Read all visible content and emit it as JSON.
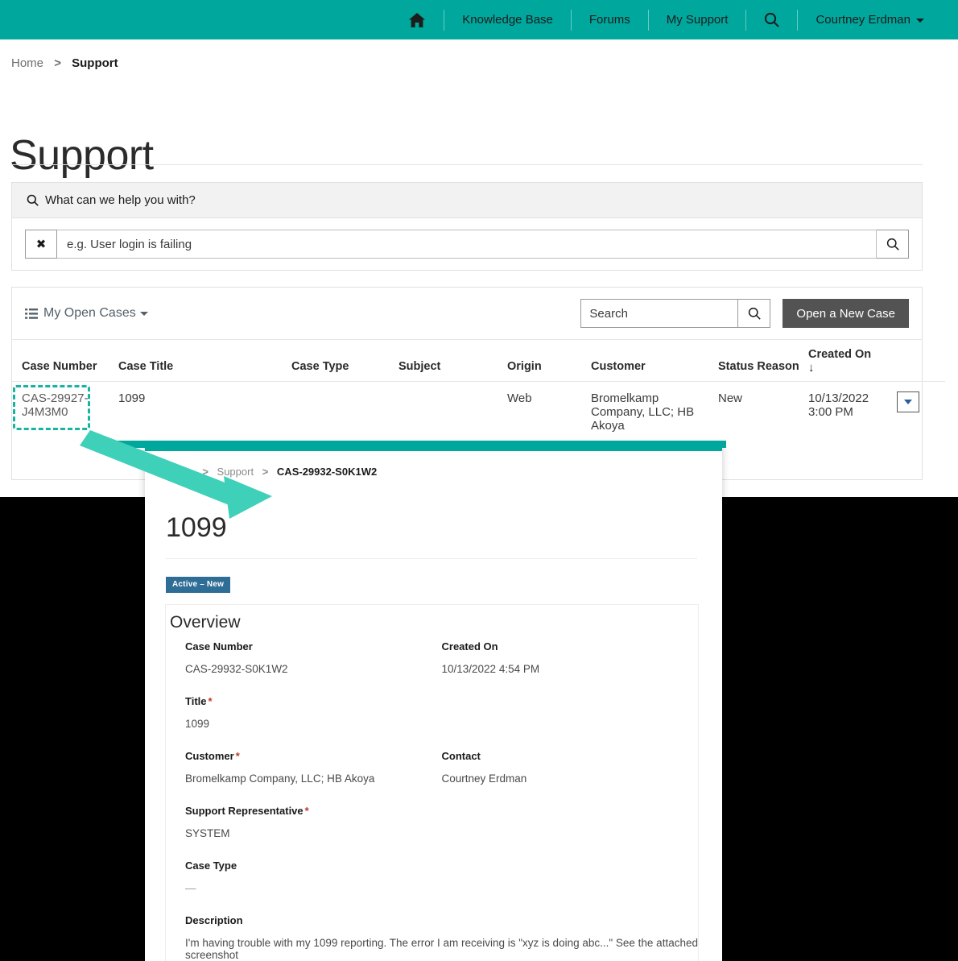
{
  "topnav": {
    "home_icon": "home-icon",
    "items": [
      {
        "label": "Knowledge Base"
      },
      {
        "label": "Forums"
      },
      {
        "label": "My Support"
      }
    ],
    "search_icon": "search-icon",
    "user": "Courtney Erdman"
  },
  "breadcrumb": {
    "home": "Home",
    "separator": ">",
    "current": "Support"
  },
  "page": {
    "title": "Support"
  },
  "help": {
    "header": "What can we help you with?",
    "clear_label": "✖",
    "placeholder": "e.g. User login is failing",
    "value": ""
  },
  "toolbar": {
    "view_label": "My Open Cases",
    "search_placeholder": "Search",
    "search_value": "",
    "new_case_label": "Open a New Case"
  },
  "table": {
    "headers": {
      "case_number": "Case Number",
      "case_title": "Case Title",
      "case_type": "Case Type",
      "subject": "Subject",
      "origin": "Origin",
      "customer": "Customer",
      "status_reason": "Status Reason",
      "created_on": "Created On",
      "sort_arrow": "↓"
    },
    "rows": [
      {
        "case_number": "CAS-29927-J4M3M0",
        "case_title": "1099",
        "case_type": "",
        "subject": "",
        "origin": "Web",
        "customer": "Bromelkamp Company, LLC; HB Akoya",
        "status_reason": "New",
        "created_on": "10/13/2022 3:00 PM"
      }
    ]
  },
  "detail": {
    "breadcrumb": {
      "home": "Home",
      "support": "Support",
      "separator": ">",
      "current": "CAS-29932-S0K1W2"
    },
    "title": "1099",
    "badge": "Active – New",
    "section_title": "Overview",
    "fields": {
      "case_number_label": "Case Number",
      "case_number_value": "CAS-29932-S0K1W2",
      "created_on_label": "Created On",
      "created_on_value": "10/13/2022 4:54 PM",
      "title_label": "Title",
      "title_value": "1099",
      "customer_label": "Customer",
      "customer_value": "Bromelkamp Company, LLC; HB Akoya",
      "contact_label": "Contact",
      "contact_value": "Courtney Erdman",
      "support_rep_label": "Support Representative",
      "support_rep_value": "SYSTEM",
      "case_type_label": "Case Type",
      "case_type_value": "—",
      "description_label": "Description",
      "description_value": "I'm having trouble with my 1099 reporting. The error I am receiving is \"xyz is doing abc...\" See the attached screenshot",
      "required_marker": "*"
    }
  },
  "annotation": {
    "highlight_color": "#17b3a3",
    "arrow_color": "#3ed0b8"
  },
  "colors": {
    "nav_teal": "#00a79d",
    "button_dark": "#535353",
    "badge_blue": "#2e6d95",
    "required_red": "#c0392b"
  }
}
